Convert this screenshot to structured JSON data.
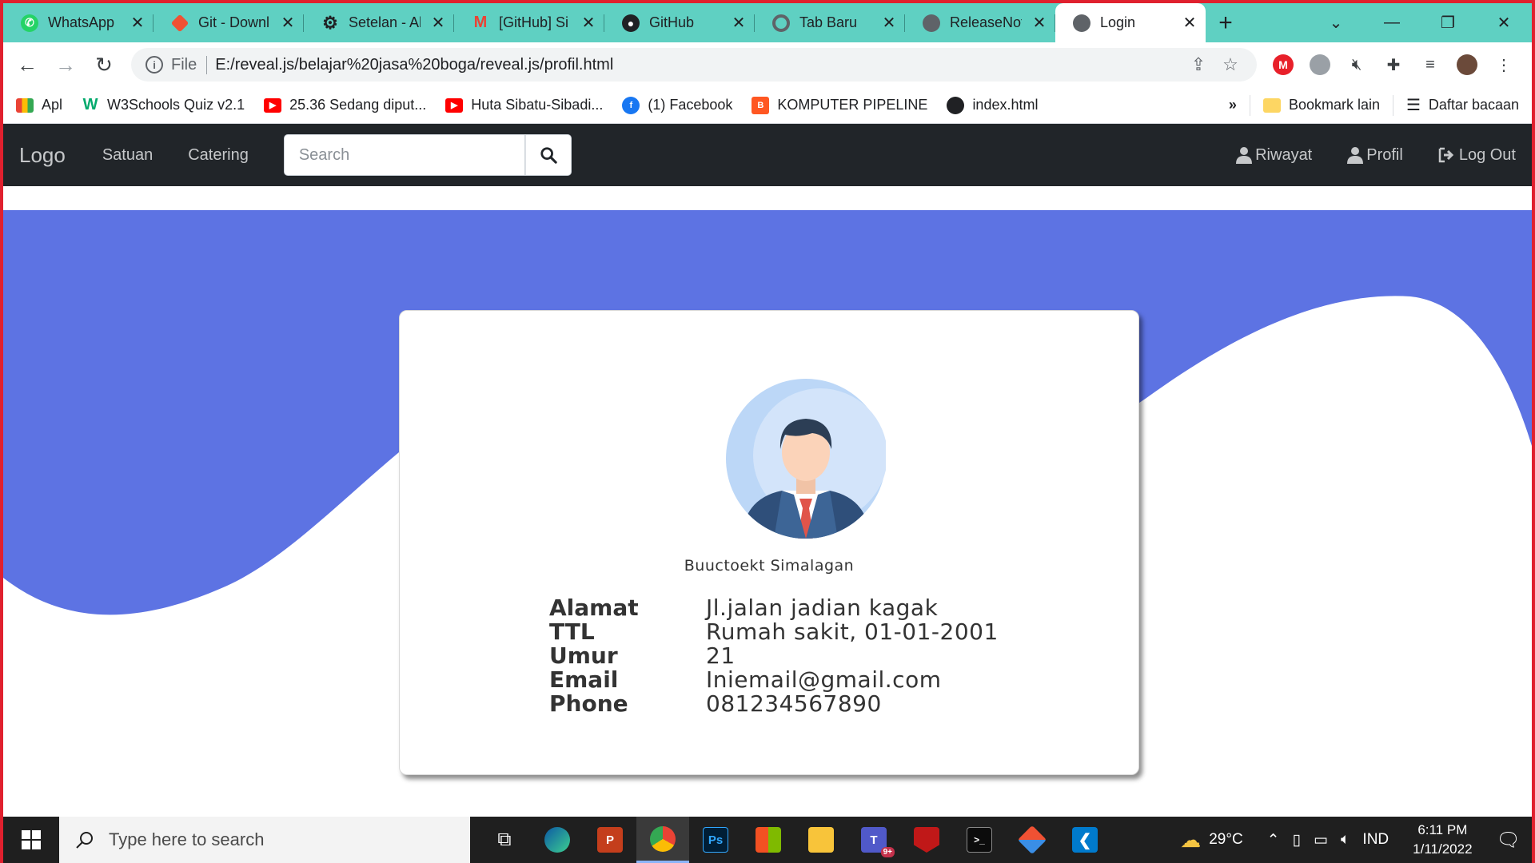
{
  "browser": {
    "tabs": [
      {
        "title": "WhatsApp",
        "icon": "whatsapp-icon",
        "color": "#25d366",
        "active": false
      },
      {
        "title": "Git - Downl",
        "icon": "git-icon",
        "color": "#f05133",
        "active": false
      },
      {
        "title": "Setelan - Al",
        "icon": "settings-gear-icon",
        "color": "#202124",
        "active": false
      },
      {
        "title": "[GitHub] Si",
        "icon": "gmail-icon",
        "color": "#ea4335",
        "active": false
      },
      {
        "title": "GitHub",
        "icon": "github-icon",
        "color": "#202124",
        "active": false
      },
      {
        "title": "Tab Baru",
        "icon": "chrome-icon",
        "color": "#5f6368",
        "active": false
      },
      {
        "title": "ReleaseNot",
        "icon": "globe-icon",
        "color": "#5f6368",
        "active": false
      },
      {
        "title": "Login",
        "icon": "globe-icon",
        "color": "#5f6368",
        "active": true
      }
    ],
    "address": {
      "scheme": "File",
      "url": "E:/reveal.js/belajar%20jasa%20boga/reveal.js/profil.html"
    },
    "bookmarks": [
      {
        "label": "Apl",
        "icon": "apps-grid-icon",
        "color": "#4285f4"
      },
      {
        "label": "W3Schools Quiz v2.1",
        "icon": "w3schools-icon",
        "color": "#04aa6d"
      },
      {
        "label": "25.36 Sedang diput...",
        "icon": "youtube-icon",
        "color": "#ff0000"
      },
      {
        "label": "Huta Sibatu-Sibadi...",
        "icon": "youtube-icon",
        "color": "#ff0000"
      },
      {
        "label": "(1) Facebook",
        "icon": "facebook-icon",
        "color": "#1877f2"
      },
      {
        "label": "KOMPUTER PIPELINE",
        "icon": "blogger-icon",
        "color": "#ff5722"
      },
      {
        "label": "index.html",
        "icon": "globe-icon",
        "color": "#202124"
      }
    ],
    "bookmarks_more": "»",
    "bookmark_folder": "Bookmark lain",
    "reading_list": "Daftar bacaan"
  },
  "page": {
    "navbar": {
      "logo": "Logo",
      "links": [
        "Satuan",
        "Catering"
      ],
      "search_placeholder": "Search",
      "right_links": [
        {
          "label": "Riwayat",
          "icon": "user-icon"
        },
        {
          "label": "Profil",
          "icon": "user-icon"
        },
        {
          "label": "Log Out",
          "icon": "sign-out-icon"
        }
      ]
    },
    "profile": {
      "name": "Buuctoekt Simalagan",
      "fields": [
        {
          "label": "Alamat",
          "value": "Jl.jalan jadian kagak"
        },
        {
          "label": "TTL",
          "value": "Rumah sakit, 01-01-2001"
        },
        {
          "label": "Umur",
          "value": "21"
        },
        {
          "label": "Email",
          "value": "Iniemail@gmail.com"
        },
        {
          "label": "Phone",
          "value": "081234567890"
        }
      ]
    },
    "colors": {
      "navbar": "#212529",
      "wave": "#5d73e3",
      "card": "#ffffff"
    }
  },
  "taskbar": {
    "search_placeholder": "Type here to search",
    "weather": "29°C",
    "language": "IND",
    "time": "6:11 PM",
    "date": "1/11/2022",
    "notification_badge": "9+"
  }
}
